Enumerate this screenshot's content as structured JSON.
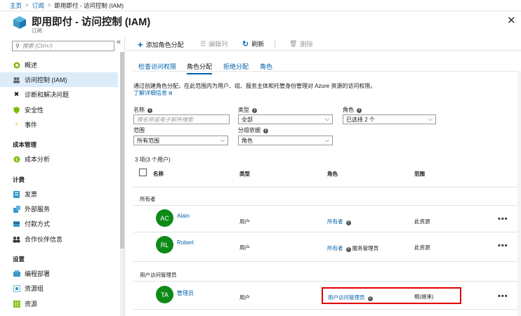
{
  "breadcrumb": {
    "items": [
      "主页",
      "订阅",
      "即用即付 - 访问控制 (IAM)"
    ]
  },
  "header": {
    "title": "即用即付 - 访问控制 (IAM)",
    "subtitle": "订阅"
  },
  "sidebar": {
    "search_placeholder": "搜索 (Ctrl+/)",
    "items": [
      {
        "label": "概述",
        "icon": "overview-icon"
      },
      {
        "label": "访问控制 (IAM)",
        "icon": "people-icon",
        "active": true
      },
      {
        "label": "诊断和解决问题",
        "icon": "wrench-icon"
      },
      {
        "label": "安全性",
        "icon": "shield-icon"
      },
      {
        "label": "事件",
        "icon": "lightning-icon"
      }
    ],
    "sections": [
      {
        "title": "成本管理",
        "items": [
          {
            "label": "成本分析",
            "icon": "cost-analysis-icon"
          }
        ]
      },
      {
        "title": "计费",
        "items": [
          {
            "label": "发票",
            "icon": "invoice-icon"
          },
          {
            "label": "外部服务",
            "icon": "external-services-icon"
          },
          {
            "label": "付款方式",
            "icon": "payment-icon"
          },
          {
            "label": "合作伙伴信息",
            "icon": "partner-icon"
          }
        ]
      },
      {
        "title": "设置",
        "items": [
          {
            "label": "编程部署",
            "icon": "deployment-icon"
          },
          {
            "label": "资源组",
            "icon": "resource-group-icon"
          },
          {
            "label": "资源",
            "icon": "resources-icon"
          }
        ]
      }
    ]
  },
  "toolbar": {
    "add_label": "添加角色分配",
    "edit_columns_label": "编辑列",
    "refresh_label": "刷新",
    "delete_label": "删除"
  },
  "tabs": [
    "检查访问权限",
    "角色分配",
    "拒绝分配",
    "角色"
  ],
  "description": "通过创建角色分配，在此范围内为用户、组、服务主体和托管身份管理对 Azure 资源的访问权限。",
  "learn_more": "了解详细信息",
  "filters": {
    "name_label": "名称",
    "name_placeholder": "按名称或电子邮件搜索",
    "type_label": "类型",
    "type_value": "全部",
    "role_label": "角色",
    "role_value": "已选择 2 个",
    "scope_label": "范围",
    "scope_value": "所有范围",
    "group_label": "分组依据",
    "group_value": "角色"
  },
  "table": {
    "count": "3 项(3 个用户)",
    "columns": [
      "名称",
      "类型",
      "角色",
      "范围"
    ],
    "groups": [
      {
        "title": "所有者",
        "rows": [
          {
            "initials": "AC",
            "name": "Alain",
            "type": "用户",
            "role": "所有者",
            "role_extra": "",
            "scope": "此资源"
          },
          {
            "initials": "RL",
            "name": "Robert",
            "type": "用户",
            "role": "所有者",
            "role_extra": "服务管理员",
            "scope": "此资源"
          }
        ]
      },
      {
        "title": "用户访问管理员",
        "rows": [
          {
            "initials": "TA",
            "name": "管理员",
            "type": "用户",
            "role": "用户访问管理员",
            "role_extra": "",
            "scope": "根(继承)"
          }
        ]
      }
    ]
  },
  "colors": {
    "accent": "#0062ad",
    "avatar": "#0e8a16",
    "highlight": "#e00000",
    "active_nav": "#dcecf9"
  }
}
